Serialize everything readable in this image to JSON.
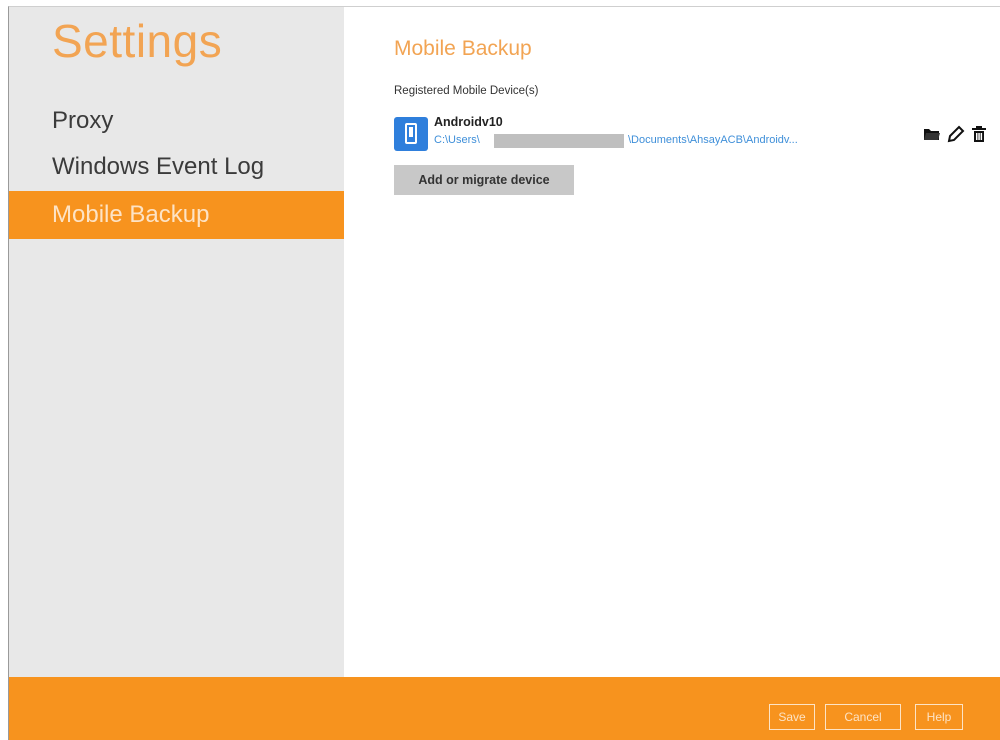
{
  "sidebar": {
    "title": "Settings",
    "items": [
      {
        "label": "Proxy",
        "active": false
      },
      {
        "label": "Windows Event Log",
        "active": false
      },
      {
        "label": "Mobile Backup",
        "active": true
      }
    ]
  },
  "main": {
    "title": "Mobile Backup",
    "section_label": "Registered Mobile Device(s)",
    "device": {
      "icon": "mobile-phone-icon",
      "name": "Androidv10",
      "path_prefix": "C:\\Users\\",
      "path_suffix": "\\Documents\\AhsayACB\\Androidv...",
      "actions": [
        "folder-icon",
        "edit-icon",
        "trash-icon"
      ]
    },
    "add_button": "Add or migrate device"
  },
  "footer": {
    "save": "Save",
    "cancel": "Cancel",
    "help": "Help"
  },
  "colors": {
    "accent": "#f7931e",
    "title": "#f2a453",
    "link": "#3f8fd9",
    "sidebar_bg": "#e8e8e8"
  }
}
